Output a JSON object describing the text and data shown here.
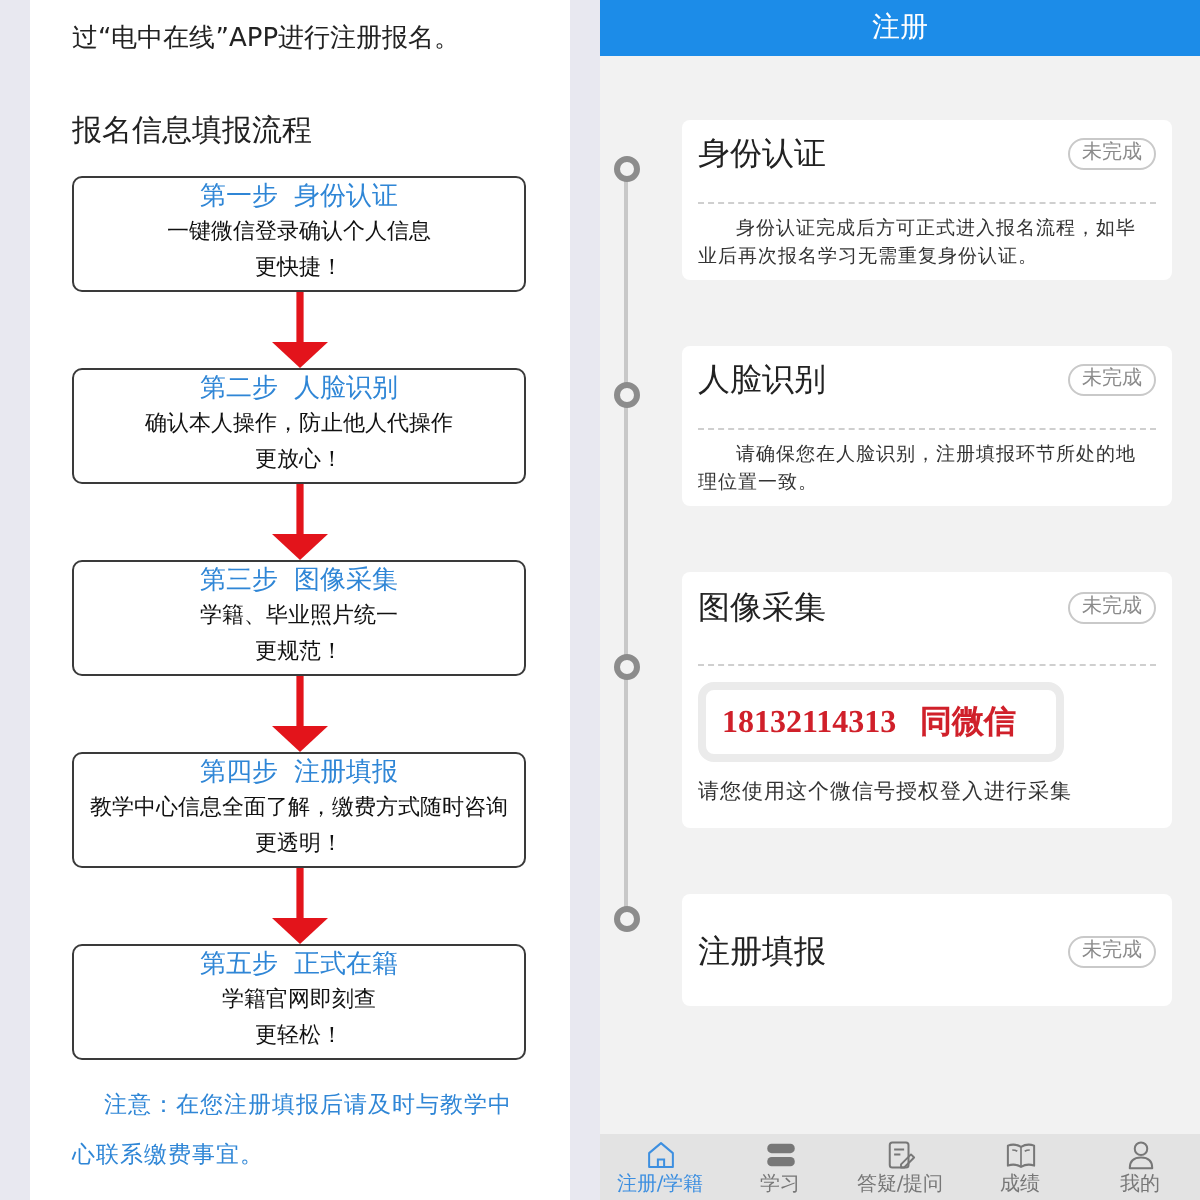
{
  "left_panel": {
    "intro": "过“电中在线”APP进行注册报名。",
    "heading": "报名信息填报流程",
    "steps": [
      {
        "number": "第一步",
        "title": "身份认证",
        "desc": "一键微信登录确认个人信息",
        "slogan": "更快捷！"
      },
      {
        "number": "第二步",
        "title": "人脸识别",
        "desc": "确认本人操作，防止他人代操作",
        "slogan": "更放心！"
      },
      {
        "number": "第三步",
        "title": "图像采集",
        "desc": "学籍、毕业照片统一",
        "slogan": "更规范！"
      },
      {
        "number": "第四步",
        "title": "注册填报",
        "desc": "教学中心信息全面了解，缴费方式随时咨询",
        "slogan": "更透明！"
      },
      {
        "number": "第五步",
        "title": "正式在籍",
        "desc": "学籍官网即刻查",
        "slogan": "更轻松！"
      }
    ],
    "note": "注意：在您注册填报后请及时与教学中心联系缴费事宜。"
  },
  "header": {
    "title": "注册"
  },
  "timeline": [
    {
      "kind": "info",
      "title": "身份认证",
      "status": "未完成",
      "desc": "身份认证完成后方可正式进入报名流程，如毕业后再次报名学习无需重复身份认证。"
    },
    {
      "kind": "info",
      "title": "人脸识别",
      "status": "未完成",
      "desc": "请确保您在人脸识别，注册填报环节所处的地理位置一致。"
    },
    {
      "kind": "contact",
      "title": "图像采集",
      "status": "未完成",
      "contact": "18132114313 同微信",
      "desc": "请您使用这个微信号授权登入进行采集"
    },
    {
      "kind": "title_only",
      "title": "注册填报",
      "status": "未完成"
    }
  ],
  "tab_bar": [
    {
      "label": "注册/学籍",
      "selected": true
    },
    {
      "label": "学习",
      "selected": false
    },
    {
      "label": "答疑/提问",
      "selected": false
    },
    {
      "label": "成绩",
      "selected": false
    },
    {
      "label": "我的",
      "selected": false
    }
  ]
}
